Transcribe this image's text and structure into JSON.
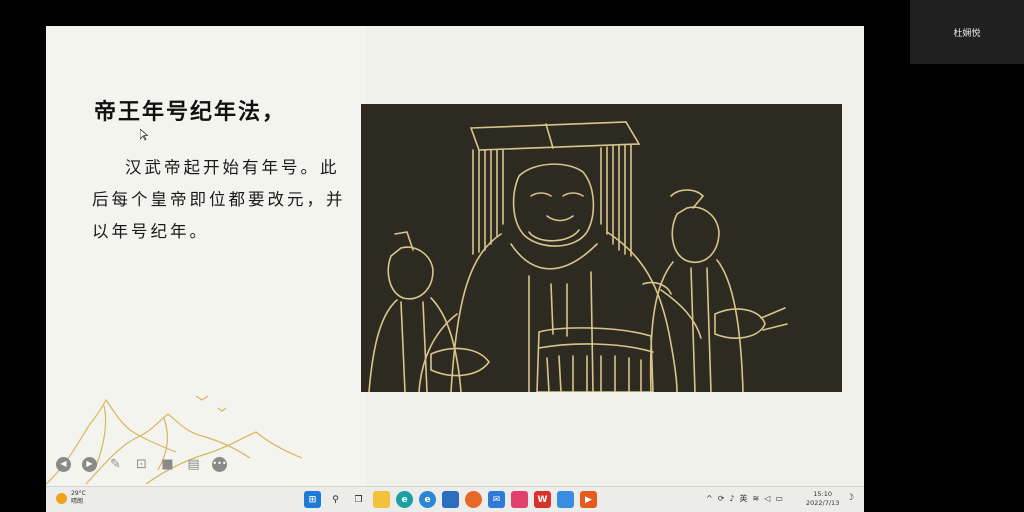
{
  "participant": {
    "name": "杜娴悦"
  },
  "slide": {
    "title": "帝王年号纪年法，",
    "body": "汉武帝起开始有年号。此后每个皇帝即位都要改元，并以年号纪年。"
  },
  "slide_controls": [
    "previous-icon",
    "next-icon",
    "pen-icon",
    "zoom-icon",
    "camera-icon",
    "subtitle-icon",
    "more-icon"
  ],
  "taskbar": {
    "weather": {
      "temp": "29°C",
      "condition": "晴朗"
    },
    "apps": [
      "windows-start-icon",
      "search-icon",
      "task-view-icon",
      "file-explorer-icon",
      "edge-icon",
      "ie-icon",
      "store-icon",
      "firefox-icon",
      "mail-icon",
      "app-icon",
      "wps-icon",
      "photos-icon",
      "media-player-icon"
    ],
    "tray": {
      "ime": "英"
    },
    "clock": {
      "time": "15:10",
      "date": "2022/7/13"
    }
  },
  "colors": {
    "slide_bg": "#f1f1ec",
    "painting_bg": "#2d2a22",
    "line_gold": "#d9c58a",
    "taskbar_bg": "#ececea"
  }
}
